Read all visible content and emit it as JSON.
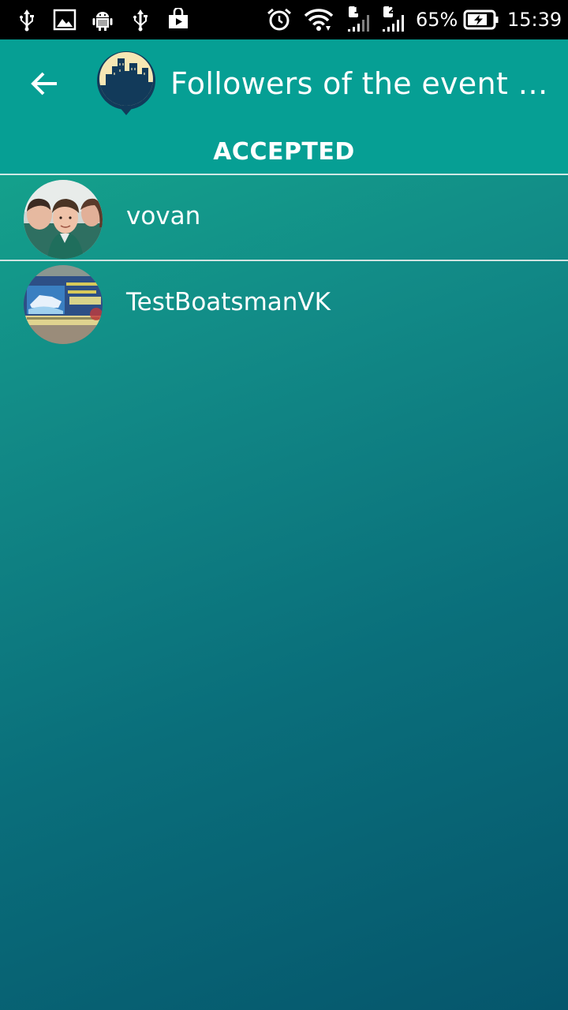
{
  "status_bar": {
    "battery_percent": "65%",
    "time": "15:39",
    "sim1": "1",
    "sim2": "2",
    "icons": [
      "usb-icon",
      "image-icon",
      "android-icon",
      "usb-icon",
      "play-store-icon",
      "alarm-icon",
      "wifi-icon",
      "signal-icon",
      "signal-icon",
      "battery-icon"
    ]
  },
  "app_bar": {
    "title": "Followers of the event ”Fo...",
    "back_icon": "arrow-left-icon",
    "logo_icon": "city-pin-logo"
  },
  "tabs": [
    {
      "label": "ACCEPTED",
      "selected": true
    }
  ],
  "followers": [
    {
      "name": "vovan",
      "avatar": "group-selfie-photo"
    },
    {
      "name": "TestBoatsmanVK",
      "avatar": "boat-poster-photo"
    }
  ],
  "colors": {
    "status_bar": "#000000",
    "app_bar": "#069f94",
    "gradient_top": "#15b08f",
    "gradient_bottom": "#05566c",
    "divider": "#cfe3e1",
    "logo_navy": "#123a5a",
    "logo_cream": "#f7e7b4"
  }
}
